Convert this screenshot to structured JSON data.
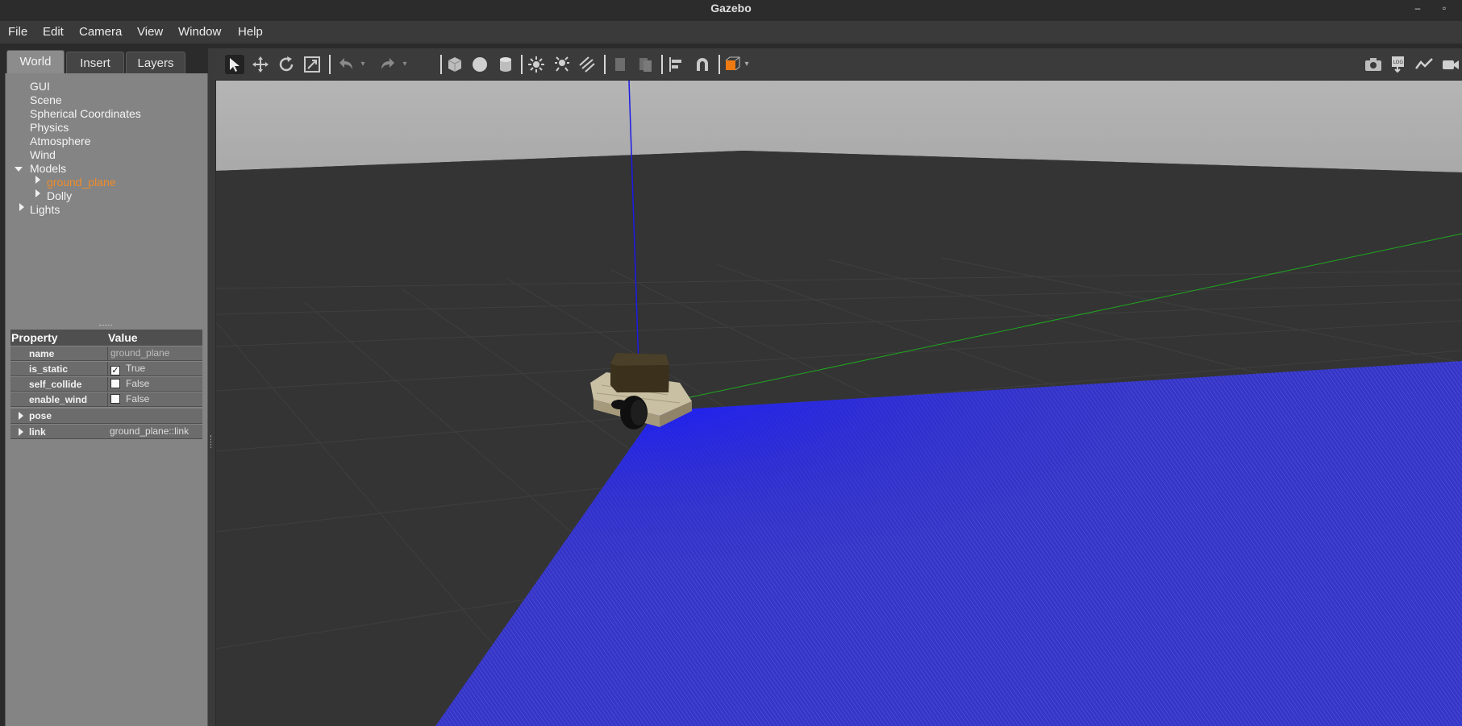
{
  "window": {
    "title": "Gazebo"
  },
  "menu": [
    "File",
    "Edit",
    "Camera",
    "View",
    "Window",
    "Help"
  ],
  "tabs": {
    "world": "World",
    "insert": "Insert",
    "layers": "Layers"
  },
  "tree": {
    "gui": "GUI",
    "scene": "Scene",
    "spherical": "Spherical Coordinates",
    "physics": "Physics",
    "atmosphere": "Atmosphere",
    "wind": "Wind",
    "models": "Models",
    "ground_plane": "ground_plane",
    "dolly": "Dolly",
    "lights": "Lights"
  },
  "properties": {
    "header_property": "Property",
    "header_value": "Value",
    "name_label": "name",
    "name_value": "ground_plane",
    "is_static_label": "is_static",
    "is_static_value": "True",
    "self_collide_label": "self_collide",
    "self_collide_value": "False",
    "enable_wind_label": "enable_wind",
    "enable_wind_value": "False",
    "pose_label": "pose",
    "link_label": "link",
    "link_value": "ground_plane::link"
  },
  "toolbar": {
    "tools": [
      "select-mode",
      "translate-mode",
      "rotate-mode",
      "scale-mode",
      "undo",
      "redo",
      "box-shape",
      "sphere-shape",
      "cylinder-shape",
      "point-light",
      "spot-light",
      "directional-light",
      "copy",
      "paste",
      "align",
      "snap",
      "view-angle",
      "screenshot",
      "log",
      "plot",
      "video-record"
    ]
  },
  "colors": {
    "selected_tree_item": "#f08c2a",
    "laser_rays": "#2020e0",
    "z_axis": "#1a1ae6",
    "y_axis": "#1ea81e"
  }
}
